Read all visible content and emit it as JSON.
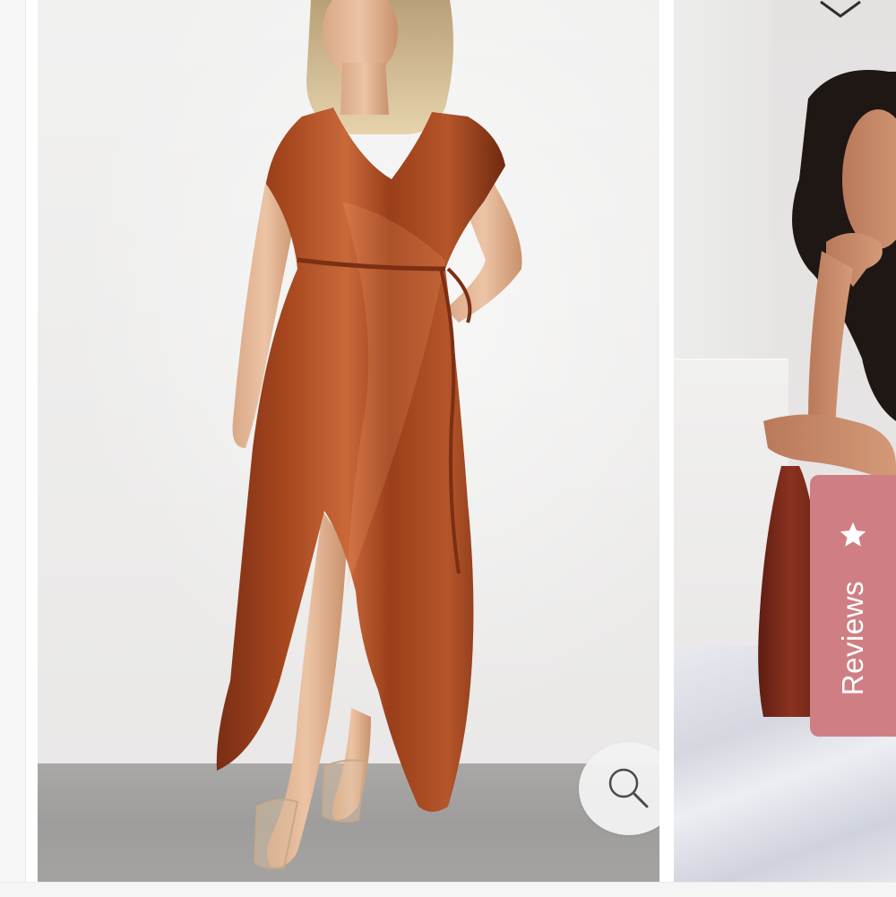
{
  "gallery": {
    "main_image": {
      "icon": "wrap-dress-photo",
      "colors": {
        "dress": "#8e3b1d",
        "wall": "#efefee",
        "floor": "#a3a2a0"
      }
    },
    "next_image": {
      "icon": "model-seated-photo"
    },
    "zoom_button": {
      "icon": "search-icon"
    }
  },
  "reviews_tab": {
    "label": "Reviews",
    "icon": "star-icon",
    "color": "#cf7f84"
  },
  "indicator": {
    "icon": "chevron-down-icon"
  }
}
